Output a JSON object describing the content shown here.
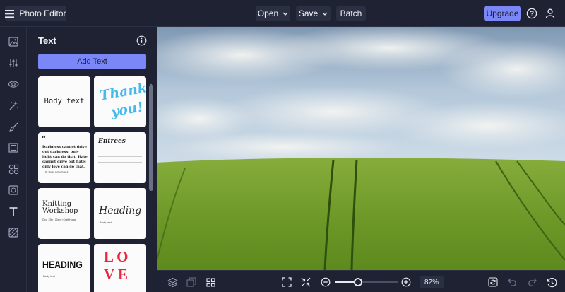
{
  "app": {
    "title": "Photo Editor"
  },
  "toolbar": {
    "open_label": "Open",
    "save_label": "Save",
    "batch_label": "Batch",
    "upgrade_label": "Upgrade"
  },
  "panel": {
    "title": "Text",
    "add_text_label": "Add Text",
    "templates": {
      "body_text": "Body text",
      "thank_you_line1": "Thank",
      "thank_you_line2": "you!",
      "quote": "Darkness cannot drive out darkness; only light can do that. Hate cannot drive out hate; only love can do that.",
      "quote_author": "Dr. Martin Luther King Jr.",
      "list_title": "Entrees",
      "knitting_title_line1": "Knitting",
      "knitting_title_line2": "Workshop",
      "knitting_meta": "Dec. 13th | 10am | Craft House",
      "heading_script": "Heading",
      "heading_script_sub": "Body text",
      "heading_bold": "HEADING",
      "heading_bold_sub": "Body text",
      "love_line1": "L O",
      "love_line2": "V E"
    }
  },
  "bottom": {
    "zoom_label": "82%",
    "zoom_value": 0.35
  },
  "colors": {
    "accent": "#7c87f7",
    "bg": "#1f2233",
    "grass": "#6e9a2a",
    "sky": "#b8cbdc"
  }
}
